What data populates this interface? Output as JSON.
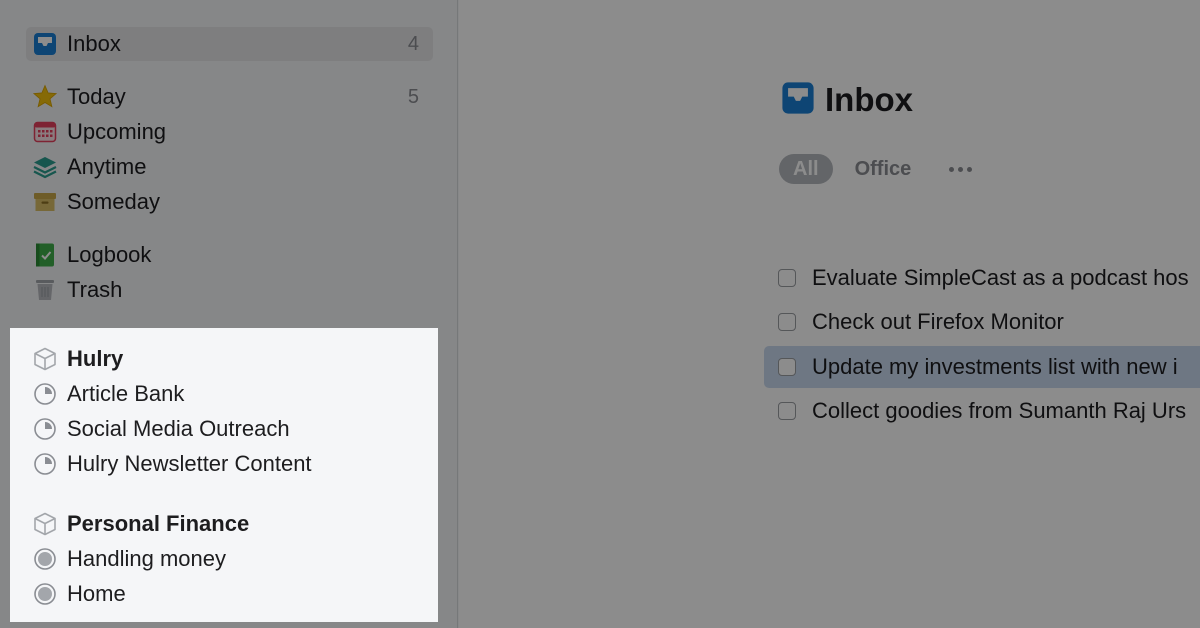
{
  "sidebar": {
    "inbox": {
      "label": "Inbox",
      "count": "4",
      "icon": "inbox-tray-icon",
      "color": "#1a7fd4"
    },
    "today": {
      "label": "Today",
      "count": "5",
      "icon": "star-icon",
      "color": "#f4c20d"
    },
    "upcoming": {
      "label": "Upcoming",
      "icon": "calendar-icon",
      "color": "#e5405e"
    },
    "anytime": {
      "label": "Anytime",
      "icon": "layers-icon",
      "color": "#2a9d8f"
    },
    "someday": {
      "label": "Someday",
      "icon": "archive-box-icon",
      "color": "#c9a84a"
    },
    "logbook": {
      "label": "Logbook",
      "icon": "logbook-icon",
      "color": "#3fae49"
    },
    "trash": {
      "label": "Trash",
      "icon": "trash-icon",
      "color": "#a3a6ab"
    }
  },
  "areas": [
    {
      "label": "Hulry",
      "icon": "area-cube-icon",
      "projects": [
        {
          "label": "Article Bank",
          "icon": "project-progress-icon"
        },
        {
          "label": "Social Media Outreach",
          "icon": "project-progress-icon"
        },
        {
          "label": "Hulry Newsletter Content",
          "icon": "project-progress-icon"
        }
      ]
    },
    {
      "label": "Personal Finance",
      "icon": "area-cube-icon",
      "projects": [
        {
          "label": "Handling money",
          "icon": "project-filled-icon"
        },
        {
          "label": "Home",
          "icon": "project-filled-icon"
        }
      ]
    }
  ],
  "main": {
    "title": "Inbox",
    "tabs": [
      {
        "label": "All",
        "active": true
      },
      {
        "label": "Office",
        "active": false
      }
    ],
    "more_icon": "ellipsis-icon",
    "tasks": [
      {
        "label": "Evaluate SimpleCast as a podcast hos"
      },
      {
        "label": "Check out Firefox Monitor"
      },
      {
        "label": "Update my investments list with new i",
        "highlighted": true
      },
      {
        "label": "Collect goodies from Sumanth Raj Urs"
      }
    ]
  },
  "colors": {
    "accent_blue": "#1a7fd4",
    "selection": "#c8d9ef",
    "sidebar_bg": "#f5f6f8",
    "overlay": "rgba(0,0,0,0.45)"
  }
}
